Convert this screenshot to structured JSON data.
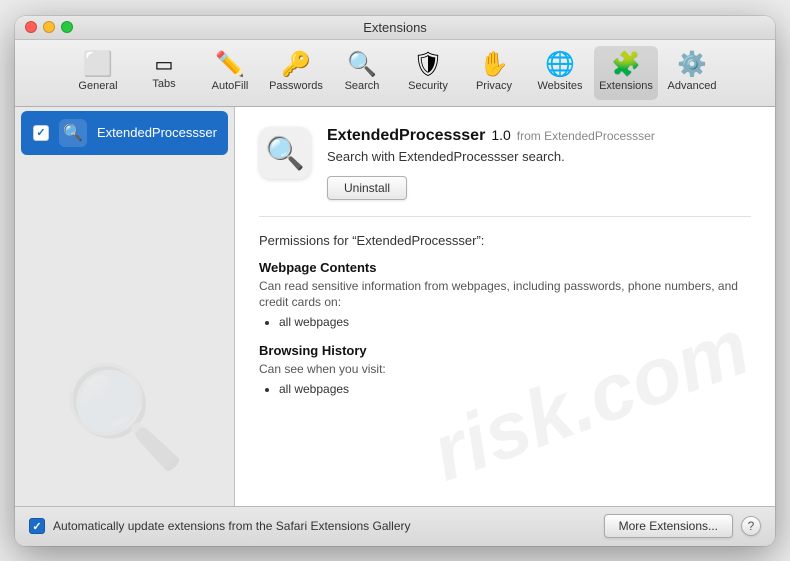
{
  "window": {
    "title": "Extensions"
  },
  "toolbar": {
    "items": [
      {
        "id": "general",
        "label": "General",
        "icon": "⬜"
      },
      {
        "id": "tabs",
        "label": "Tabs",
        "icon": "◫"
      },
      {
        "id": "autofill",
        "label": "AutoFill",
        "icon": "✏"
      },
      {
        "id": "passwords",
        "label": "Passwords",
        "icon": "🔑"
      },
      {
        "id": "search",
        "label": "Search",
        "icon": "🔍"
      },
      {
        "id": "security",
        "label": "Security",
        "icon": "🛡"
      },
      {
        "id": "privacy",
        "label": "Privacy",
        "icon": "✋"
      },
      {
        "id": "websites",
        "label": "Websites",
        "icon": "🌐"
      },
      {
        "id": "extensions",
        "label": "Extensions",
        "icon": "🧩"
      },
      {
        "id": "advanced",
        "label": "Advanced",
        "icon": "⚙"
      }
    ],
    "active": "extensions"
  },
  "sidebar": {
    "items": [
      {
        "id": "extendedprocesser",
        "name": "ExtendedProcessser",
        "checked": true,
        "selected": true
      }
    ]
  },
  "detail": {
    "ext_name": "ExtendedProcessser",
    "ext_version": "1.0",
    "ext_from_label": "from",
    "ext_from": "ExtendedProcessser",
    "ext_description": "Search with ExtendedProcessser search.",
    "uninstall_label": "Uninstall",
    "permissions_title": "Permissions for “ExtendedProcessser”:",
    "permissions": [
      {
        "name": "Webpage Contents",
        "description": "Can read sensitive information from webpages, including passwords, phone numbers, and credit cards on:",
        "items": [
          "all webpages"
        ]
      },
      {
        "name": "Browsing History",
        "description": "Can see when you visit:",
        "items": [
          "all webpages"
        ]
      }
    ]
  },
  "bottom_bar": {
    "auto_update_label": "Automatically update extensions from the Safari Extensions Gallery",
    "more_extensions_label": "More Extensions...",
    "help_label": "?"
  }
}
